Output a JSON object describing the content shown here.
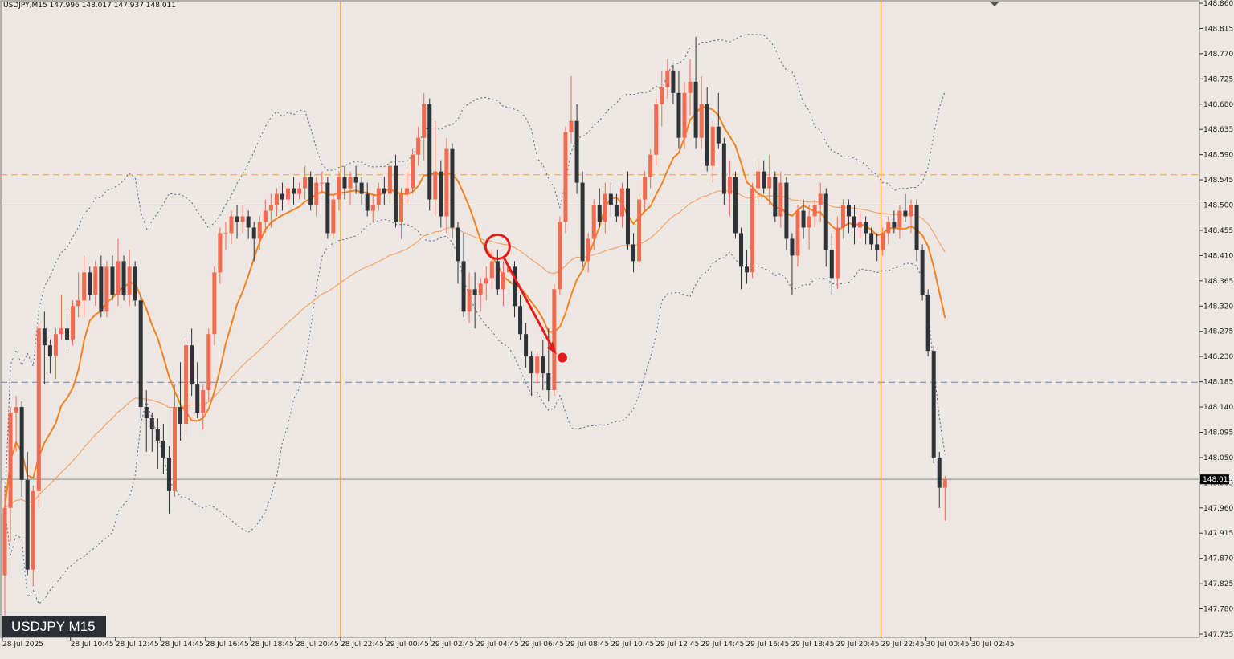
{
  "header": {
    "symbol_line": "USDJPY,M15  147.996 148.017 147.937 148.011"
  },
  "badge": {
    "label": "USDJPY M15"
  },
  "colors": {
    "background": "#ece7e3",
    "bull": "#f26a4f",
    "bear": "#2e3338",
    "ma_fast": "#f5821f",
    "ma_slow": "#f7a060",
    "bollinger": "#5a6a8a",
    "resistance": "#f5a623",
    "support": "#6c84b4",
    "session": "#f39a1e",
    "annotation": "#e31c1c",
    "price_tag": "#000000"
  },
  "chart_data": {
    "type": "candlestick",
    "symbol": "USDJPY",
    "timeframe": "M15",
    "ohlc_header": {
      "open": 147.996,
      "high": 148.017,
      "low": 147.937,
      "close": 148.011
    },
    "current_price": 148.011,
    "current_price_label": "148.011",
    "ylim": [
      147.735,
      148.86
    ],
    "y_ticks": [
      "148.860",
      "148.815",
      "148.770",
      "148.725",
      "148.680",
      "148.635",
      "148.590",
      "148.545",
      "148.500",
      "148.455",
      "148.410",
      "148.365",
      "148.320",
      "148.275",
      "148.230",
      "148.185",
      "148.140",
      "148.095",
      "148.050",
      "148.005",
      "147.960",
      "147.915",
      "147.870",
      "147.825",
      "147.780",
      "147.735"
    ],
    "x_ticks": [
      "28 Jul 2025",
      "28 Jul 10:45",
      "28 Jul 12:45",
      "28 Jul 14:45",
      "28 Jul 16:45",
      "28 Jul 18:45",
      "28 Jul 20:45",
      "28 Jul 22:45",
      "29 Jul 00:45",
      "29 Jul 02:45",
      "29 Jul 04:45",
      "29 Jul 06:45",
      "29 Jul 08:45",
      "29 Jul 10:45",
      "29 Jul 12:45",
      "29 Jul 14:45",
      "29 Jul 16:45",
      "29 Jul 18:45",
      "29 Jul 20:45",
      "29 Jul 22:45",
      "30 Jul 00:45",
      "30 Jul 02:45"
    ],
    "horizontal_lines": [
      {
        "name": "resistance",
        "price": 148.554,
        "style": "dashed"
      },
      {
        "name": "support",
        "price": 148.184,
        "style": "dashed"
      },
      {
        "name": "level-148-5",
        "price": 148.5,
        "style": "solid-light"
      }
    ],
    "session_separators": [
      "28 Jul 22:45",
      "29 Jul 22:45"
    ],
    "annotation": {
      "circle_candle_index": 87,
      "arrow_to_candle_index": 98,
      "dot_price": 148.228
    },
    "candles": [
      {
        "o": 147.84,
        "h": 148.0,
        "l": 147.76,
        "c": 147.96
      },
      {
        "o": 147.96,
        "h": 148.14,
        "l": 147.9,
        "c": 148.13
      },
      {
        "o": 148.13,
        "h": 148.16,
        "l": 148.06,
        "c": 148.14
      },
      {
        "o": 148.14,
        "h": 148.15,
        "l": 147.98,
        "c": 148.01
      },
      {
        "o": 148.01,
        "h": 148.06,
        "l": 147.84,
        "c": 147.85
      },
      {
        "o": 147.85,
        "h": 148.0,
        "l": 147.82,
        "c": 147.99
      },
      {
        "o": 147.99,
        "h": 148.29,
        "l": 147.96,
        "c": 148.28
      },
      {
        "o": 148.28,
        "h": 148.31,
        "l": 148.18,
        "c": 148.25
      },
      {
        "o": 148.25,
        "h": 148.26,
        "l": 148.2,
        "c": 148.23
      },
      {
        "o": 148.23,
        "h": 148.28,
        "l": 148.19,
        "c": 148.27
      },
      {
        "o": 148.27,
        "h": 148.34,
        "l": 148.26,
        "c": 148.28
      },
      {
        "o": 148.28,
        "h": 148.31,
        "l": 148.24,
        "c": 148.26
      },
      {
        "o": 148.26,
        "h": 148.33,
        "l": 148.25,
        "c": 148.32
      },
      {
        "o": 148.32,
        "h": 148.38,
        "l": 148.3,
        "c": 148.33
      },
      {
        "o": 148.33,
        "h": 148.41,
        "l": 148.3,
        "c": 148.38
      },
      {
        "o": 148.38,
        "h": 148.39,
        "l": 148.33,
        "c": 148.34
      },
      {
        "o": 148.34,
        "h": 148.4,
        "l": 148.32,
        "c": 148.39
      },
      {
        "o": 148.39,
        "h": 148.41,
        "l": 148.3,
        "c": 148.31
      },
      {
        "o": 148.31,
        "h": 148.4,
        "l": 148.3,
        "c": 148.39
      },
      {
        "o": 148.39,
        "h": 148.41,
        "l": 148.33,
        "c": 148.34
      },
      {
        "o": 148.34,
        "h": 148.44,
        "l": 148.32,
        "c": 148.4
      },
      {
        "o": 148.4,
        "h": 148.41,
        "l": 148.33,
        "c": 148.34
      },
      {
        "o": 148.34,
        "h": 148.42,
        "l": 148.32,
        "c": 148.39
      },
      {
        "o": 148.39,
        "h": 148.4,
        "l": 148.32,
        "c": 148.33
      },
      {
        "o": 148.33,
        "h": 148.34,
        "l": 148.12,
        "c": 148.14
      },
      {
        "o": 148.14,
        "h": 148.17,
        "l": 148.06,
        "c": 148.12
      },
      {
        "o": 148.12,
        "h": 148.13,
        "l": 148.06,
        "c": 148.1
      },
      {
        "o": 148.1,
        "h": 148.12,
        "l": 148.03,
        "c": 148.08
      },
      {
        "o": 148.08,
        "h": 148.11,
        "l": 148.02,
        "c": 148.05
      },
      {
        "o": 148.05,
        "h": 148.07,
        "l": 147.95,
        "c": 147.99
      },
      {
        "o": 147.99,
        "h": 148.18,
        "l": 147.98,
        "c": 148.14
      },
      {
        "o": 148.14,
        "h": 148.22,
        "l": 148.08,
        "c": 148.11
      },
      {
        "o": 148.11,
        "h": 148.26,
        "l": 148.09,
        "c": 148.25
      },
      {
        "o": 148.25,
        "h": 148.28,
        "l": 148.16,
        "c": 148.18
      },
      {
        "o": 148.18,
        "h": 148.22,
        "l": 148.12,
        "c": 148.13
      },
      {
        "o": 148.13,
        "h": 148.18,
        "l": 148.1,
        "c": 148.17
      },
      {
        "o": 148.17,
        "h": 148.28,
        "l": 148.15,
        "c": 148.27
      },
      {
        "o": 148.27,
        "h": 148.39,
        "l": 148.25,
        "c": 148.38
      },
      {
        "o": 148.38,
        "h": 148.46,
        "l": 148.36,
        "c": 148.45
      },
      {
        "o": 148.45,
        "h": 148.47,
        "l": 148.42,
        "c": 148.45
      },
      {
        "o": 148.45,
        "h": 148.49,
        "l": 148.43,
        "c": 148.48
      },
      {
        "o": 148.48,
        "h": 148.5,
        "l": 148.44,
        "c": 148.47
      },
      {
        "o": 148.47,
        "h": 148.5,
        "l": 148.45,
        "c": 148.48
      },
      {
        "o": 148.48,
        "h": 148.49,
        "l": 148.44,
        "c": 148.46
      },
      {
        "o": 148.46,
        "h": 148.47,
        "l": 148.4,
        "c": 148.44
      },
      {
        "o": 148.44,
        "h": 148.48,
        "l": 148.42,
        "c": 148.47
      },
      {
        "o": 148.47,
        "h": 148.51,
        "l": 148.45,
        "c": 148.49
      },
      {
        "o": 148.49,
        "h": 148.52,
        "l": 148.46,
        "c": 148.5
      },
      {
        "o": 148.5,
        "h": 148.53,
        "l": 148.48,
        "c": 148.52
      },
      {
        "o": 148.52,
        "h": 148.54,
        "l": 148.49,
        "c": 148.51
      },
      {
        "o": 148.51,
        "h": 148.54,
        "l": 148.5,
        "c": 148.53
      },
      {
        "o": 148.53,
        "h": 148.55,
        "l": 148.5,
        "c": 148.52
      },
      {
        "o": 148.52,
        "h": 148.54,
        "l": 148.51,
        "c": 148.53
      },
      {
        "o": 148.53,
        "h": 148.57,
        "l": 148.51,
        "c": 148.55
      },
      {
        "o": 148.55,
        "h": 148.56,
        "l": 148.49,
        "c": 148.5
      },
      {
        "o": 148.5,
        "h": 148.55,
        "l": 148.48,
        "c": 148.54
      },
      {
        "o": 148.54,
        "h": 148.56,
        "l": 148.52,
        "c": 148.54
      },
      {
        "o": 148.54,
        "h": 148.55,
        "l": 148.44,
        "c": 148.45
      },
      {
        "o": 148.45,
        "h": 148.52,
        "l": 148.44,
        "c": 148.51
      },
      {
        "o": 148.51,
        "h": 148.56,
        "l": 148.49,
        "c": 148.55
      },
      {
        "o": 148.55,
        "h": 148.57,
        "l": 148.51,
        "c": 148.53
      },
      {
        "o": 148.53,
        "h": 148.56,
        "l": 148.5,
        "c": 148.55
      },
      {
        "o": 148.55,
        "h": 148.57,
        "l": 148.52,
        "c": 148.54
      },
      {
        "o": 148.54,
        "h": 148.55,
        "l": 148.5,
        "c": 148.52
      },
      {
        "o": 148.52,
        "h": 148.54,
        "l": 148.48,
        "c": 148.49
      },
      {
        "o": 148.49,
        "h": 148.52,
        "l": 148.47,
        "c": 148.5
      },
      {
        "o": 148.5,
        "h": 148.54,
        "l": 148.49,
        "c": 148.53
      },
      {
        "o": 148.53,
        "h": 148.55,
        "l": 148.5,
        "c": 148.52
      },
      {
        "o": 148.52,
        "h": 148.58,
        "l": 148.5,
        "c": 148.57
      },
      {
        "o": 148.57,
        "h": 148.59,
        "l": 148.46,
        "c": 148.47
      },
      {
        "o": 148.47,
        "h": 148.53,
        "l": 148.44,
        "c": 148.52
      },
      {
        "o": 148.52,
        "h": 148.56,
        "l": 148.5,
        "c": 148.53
      },
      {
        "o": 148.53,
        "h": 148.6,
        "l": 148.52,
        "c": 148.59
      },
      {
        "o": 148.59,
        "h": 148.64,
        "l": 148.57,
        "c": 148.62
      },
      {
        "o": 148.62,
        "h": 148.7,
        "l": 148.58,
        "c": 148.68
      },
      {
        "o": 148.68,
        "h": 148.69,
        "l": 148.49,
        "c": 148.51
      },
      {
        "o": 148.51,
        "h": 148.65,
        "l": 148.48,
        "c": 148.56
      },
      {
        "o": 148.56,
        "h": 148.58,
        "l": 148.46,
        "c": 148.48
      },
      {
        "o": 148.48,
        "h": 148.62,
        "l": 148.45,
        "c": 148.6
      },
      {
        "o": 148.6,
        "h": 148.61,
        "l": 148.44,
        "c": 148.46
      },
      {
        "o": 148.46,
        "h": 148.47,
        "l": 148.36,
        "c": 148.4
      },
      {
        "o": 148.4,
        "h": 148.45,
        "l": 148.3,
        "c": 148.31
      },
      {
        "o": 148.31,
        "h": 148.38,
        "l": 148.29,
        "c": 148.35
      },
      {
        "o": 148.35,
        "h": 148.38,
        "l": 148.28,
        "c": 148.34
      },
      {
        "o": 148.34,
        "h": 148.37,
        "l": 148.31,
        "c": 148.36
      },
      {
        "o": 148.36,
        "h": 148.39,
        "l": 148.33,
        "c": 148.37
      },
      {
        "o": 148.37,
        "h": 148.42,
        "l": 148.35,
        "c": 148.4
      },
      {
        "o": 148.4,
        "h": 148.42,
        "l": 148.34,
        "c": 148.35
      },
      {
        "o": 148.35,
        "h": 148.4,
        "l": 148.32,
        "c": 148.38
      },
      {
        "o": 148.38,
        "h": 148.42,
        "l": 148.34,
        "c": 148.39
      },
      {
        "o": 148.39,
        "h": 148.4,
        "l": 148.3,
        "c": 148.32
      },
      {
        "o": 148.32,
        "h": 148.34,
        "l": 148.26,
        "c": 148.27
      },
      {
        "o": 148.27,
        "h": 148.29,
        "l": 148.21,
        "c": 148.23
      },
      {
        "o": 148.23,
        "h": 148.24,
        "l": 148.16,
        "c": 148.2
      },
      {
        "o": 148.2,
        "h": 148.24,
        "l": 148.18,
        "c": 148.23
      },
      {
        "o": 148.23,
        "h": 148.26,
        "l": 148.17,
        "c": 148.2
      },
      {
        "o": 148.2,
        "h": 148.28,
        "l": 148.15,
        "c": 148.17
      },
      {
        "o": 148.17,
        "h": 148.36,
        "l": 148.16,
        "c": 148.35
      },
      {
        "o": 148.35,
        "h": 148.48,
        "l": 148.34,
        "c": 148.47
      },
      {
        "o": 148.47,
        "h": 148.64,
        "l": 148.45,
        "c": 148.63
      },
      {
        "o": 148.63,
        "h": 148.73,
        "l": 148.61,
        "c": 148.65
      },
      {
        "o": 148.65,
        "h": 148.68,
        "l": 148.52,
        "c": 148.54
      },
      {
        "o": 148.54,
        "h": 148.56,
        "l": 148.39,
        "c": 148.4
      },
      {
        "o": 148.4,
        "h": 148.45,
        "l": 148.38,
        "c": 148.44
      },
      {
        "o": 148.44,
        "h": 148.51,
        "l": 148.42,
        "c": 148.5
      },
      {
        "o": 148.5,
        "h": 148.53,
        "l": 148.46,
        "c": 148.47
      },
      {
        "o": 148.47,
        "h": 148.54,
        "l": 148.45,
        "c": 148.52
      },
      {
        "o": 148.52,
        "h": 148.54,
        "l": 148.48,
        "c": 148.5
      },
      {
        "o": 148.5,
        "h": 148.52,
        "l": 148.47,
        "c": 148.48
      },
      {
        "o": 148.48,
        "h": 148.54,
        "l": 148.46,
        "c": 148.53
      },
      {
        "o": 148.53,
        "h": 148.56,
        "l": 148.42,
        "c": 148.43
      },
      {
        "o": 148.43,
        "h": 148.45,
        "l": 148.38,
        "c": 148.4
      },
      {
        "o": 148.4,
        "h": 148.52,
        "l": 148.39,
        "c": 148.51
      },
      {
        "o": 148.51,
        "h": 148.56,
        "l": 148.49,
        "c": 148.55
      },
      {
        "o": 148.55,
        "h": 148.6,
        "l": 148.53,
        "c": 148.59
      },
      {
        "o": 148.59,
        "h": 148.69,
        "l": 148.57,
        "c": 148.68
      },
      {
        "o": 148.68,
        "h": 148.74,
        "l": 148.64,
        "c": 148.71
      },
      {
        "o": 148.71,
        "h": 148.76,
        "l": 148.69,
        "c": 148.74
      },
      {
        "o": 148.74,
        "h": 148.75,
        "l": 148.68,
        "c": 148.7
      },
      {
        "o": 148.7,
        "h": 148.74,
        "l": 148.6,
        "c": 148.62
      },
      {
        "o": 148.62,
        "h": 148.72,
        "l": 148.6,
        "c": 148.7
      },
      {
        "o": 148.7,
        "h": 148.76,
        "l": 148.66,
        "c": 148.72
      },
      {
        "o": 148.72,
        "h": 148.8,
        "l": 148.6,
        "c": 148.62
      },
      {
        "o": 148.62,
        "h": 148.73,
        "l": 148.6,
        "c": 148.68
      },
      {
        "o": 148.68,
        "h": 148.71,
        "l": 148.56,
        "c": 148.57
      },
      {
        "o": 148.57,
        "h": 148.65,
        "l": 148.54,
        "c": 148.64
      },
      {
        "o": 148.64,
        "h": 148.7,
        "l": 148.6,
        "c": 148.61
      },
      {
        "o": 148.61,
        "h": 148.62,
        "l": 148.5,
        "c": 148.52
      },
      {
        "o": 148.52,
        "h": 148.58,
        "l": 148.48,
        "c": 148.55
      },
      {
        "o": 148.55,
        "h": 148.56,
        "l": 148.44,
        "c": 148.45
      },
      {
        "o": 148.45,
        "h": 148.46,
        "l": 148.35,
        "c": 148.39
      },
      {
        "o": 148.39,
        "h": 148.42,
        "l": 148.36,
        "c": 148.38
      },
      {
        "o": 148.38,
        "h": 148.54,
        "l": 148.37,
        "c": 148.53
      },
      {
        "o": 148.53,
        "h": 148.58,
        "l": 148.5,
        "c": 148.56
      },
      {
        "o": 148.56,
        "h": 148.58,
        "l": 148.52,
        "c": 148.53
      },
      {
        "o": 148.53,
        "h": 148.59,
        "l": 148.5,
        "c": 148.55
      },
      {
        "o": 148.55,
        "h": 148.56,
        "l": 148.47,
        "c": 148.48
      },
      {
        "o": 148.48,
        "h": 148.56,
        "l": 148.46,
        "c": 148.54
      },
      {
        "o": 148.54,
        "h": 148.55,
        "l": 148.42,
        "c": 148.44
      },
      {
        "o": 148.44,
        "h": 148.45,
        "l": 148.34,
        "c": 148.41
      },
      {
        "o": 148.41,
        "h": 148.5,
        "l": 148.39,
        "c": 148.49
      },
      {
        "o": 148.49,
        "h": 148.51,
        "l": 148.44,
        "c": 148.46
      },
      {
        "o": 148.46,
        "h": 148.5,
        "l": 148.42,
        "c": 148.48
      },
      {
        "o": 148.48,
        "h": 148.51,
        "l": 148.46,
        "c": 148.5
      },
      {
        "o": 148.5,
        "h": 148.54,
        "l": 148.47,
        "c": 148.52
      },
      {
        "o": 148.52,
        "h": 148.53,
        "l": 148.39,
        "c": 148.42
      },
      {
        "o": 148.42,
        "h": 148.45,
        "l": 148.34,
        "c": 148.37
      },
      {
        "o": 148.37,
        "h": 148.48,
        "l": 148.35,
        "c": 148.46
      },
      {
        "o": 148.46,
        "h": 148.51,
        "l": 148.44,
        "c": 148.5
      },
      {
        "o": 148.5,
        "h": 148.51,
        "l": 148.45,
        "c": 148.48
      },
      {
        "o": 148.48,
        "h": 148.5,
        "l": 148.43,
        "c": 148.46
      },
      {
        "o": 148.46,
        "h": 148.49,
        "l": 148.44,
        "c": 148.47
      },
      {
        "o": 148.47,
        "h": 148.48,
        "l": 148.43,
        "c": 148.45
      },
      {
        "o": 148.45,
        "h": 148.46,
        "l": 148.42,
        "c": 148.43
      },
      {
        "o": 148.43,
        "h": 148.45,
        "l": 148.4,
        "c": 148.42
      },
      {
        "o": 148.42,
        "h": 148.46,
        "l": 148.41,
        "c": 148.45
      },
      {
        "o": 148.45,
        "h": 148.48,
        "l": 148.43,
        "c": 148.47
      },
      {
        "o": 148.47,
        "h": 148.49,
        "l": 148.45,
        "c": 148.46
      },
      {
        "o": 148.46,
        "h": 148.5,
        "l": 148.44,
        "c": 148.49
      },
      {
        "o": 148.49,
        "h": 148.52,
        "l": 148.47,
        "c": 148.48
      },
      {
        "o": 148.48,
        "h": 148.51,
        "l": 148.45,
        "c": 148.5
      },
      {
        "o": 148.5,
        "h": 148.51,
        "l": 148.4,
        "c": 148.42
      },
      {
        "o": 148.42,
        "h": 148.43,
        "l": 148.33,
        "c": 148.34
      },
      {
        "o": 148.34,
        "h": 148.35,
        "l": 148.23,
        "c": 148.24
      },
      {
        "o": 148.24,
        "h": 148.25,
        "l": 148.04,
        "c": 148.05
      },
      {
        "o": 148.05,
        "h": 148.06,
        "l": 147.96,
        "c": 147.996
      },
      {
        "o": 147.996,
        "h": 148.017,
        "l": 147.937,
        "c": 148.011
      }
    ]
  }
}
